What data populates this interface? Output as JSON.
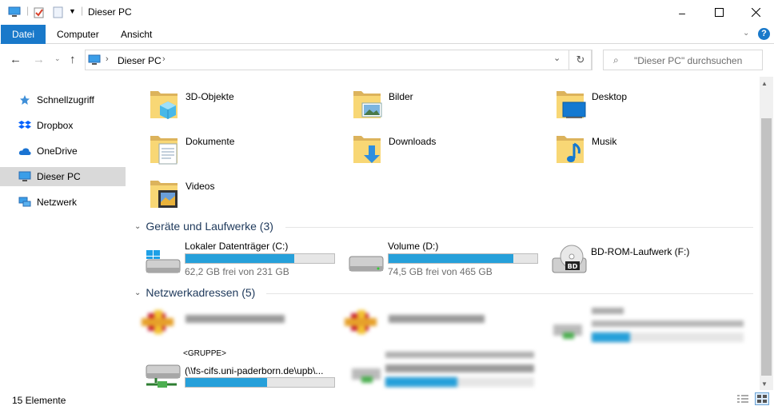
{
  "window": {
    "title": "Dieser PC"
  },
  "ribbon": {
    "tabs": [
      "Datei",
      "Computer",
      "Ansicht"
    ]
  },
  "address": {
    "path": "Dieser PC",
    "search_placeholder": "\"Dieser PC\" durchsuchen"
  },
  "sidebar": {
    "items": [
      {
        "label": "Schnellzugriff",
        "icon": "star-icon"
      },
      {
        "label": "Dropbox",
        "icon": "dropbox-icon"
      },
      {
        "label": "OneDrive",
        "icon": "cloud-icon"
      },
      {
        "label": "Dieser PC",
        "icon": "computer-icon"
      },
      {
        "label": "Netzwerk",
        "icon": "network-icon"
      }
    ]
  },
  "folders": [
    "3D-Objekte",
    "Bilder",
    "Desktop",
    "Dokumente",
    "Downloads",
    "Musik",
    "Videos"
  ],
  "groups": {
    "drives": "Geräte und Laufwerke (3)",
    "network": "Netzwerkadressen (5)"
  },
  "drives": [
    {
      "name": "Lokaler Datenträger (C:)",
      "free": "62,2 GB frei von 231 GB",
      "used_fraction": 0.73
    },
    {
      "name": "Volume (D:)",
      "free": "74,5 GB frei von 465 GB",
      "used_fraction": 0.84
    },
    {
      "name": "BD-ROM-Laufwerk (F:)"
    }
  ],
  "network": {
    "group_label": "<GRUPPE>",
    "share_path": "(\\\\fs-cifs.uni-paderborn.de\\upb\\...",
    "share_used_fraction": 0.55
  },
  "status": {
    "count": "15 Elemente"
  },
  "colors": {
    "accent": "#1979ca",
    "bar": "#26a0da",
    "group": "#1e395b"
  }
}
